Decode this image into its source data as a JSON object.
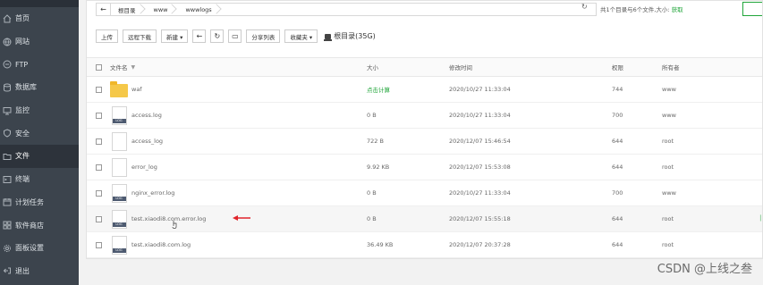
{
  "sidebar": {
    "items": [
      {
        "label": "首页",
        "icon": "home-icon"
      },
      {
        "label": "网站",
        "icon": "globe-icon"
      },
      {
        "label": "FTP",
        "icon": "ftp-icon"
      },
      {
        "label": "数据库",
        "icon": "database-icon"
      },
      {
        "label": "监控",
        "icon": "monitor-icon"
      },
      {
        "label": "安全",
        "icon": "shield-icon"
      },
      {
        "label": "文件",
        "icon": "folder-icon",
        "active": true
      },
      {
        "label": "终端",
        "icon": "terminal-icon"
      },
      {
        "label": "计划任务",
        "icon": "calendar-icon"
      },
      {
        "label": "软件商店",
        "icon": "grid-icon"
      },
      {
        "label": "面板设置",
        "icon": "gear-icon"
      },
      {
        "label": "退出",
        "icon": "logout-icon"
      }
    ]
  },
  "pathbar": {
    "back": "←",
    "crumbs": [
      "根目录",
      "www",
      "wwwlogs"
    ],
    "refresh": "↻",
    "dirinfo_prefix": "共1个目录与6个文件,大小:",
    "dirinfo_link": "获取"
  },
  "toolbar": {
    "upload": "上传",
    "remote_download": "远程下载",
    "new": "新建 ▾",
    "back_icon": "←",
    "refresh_icon": "↻",
    "terminal_icon": "▭",
    "share_list": "分享列表",
    "favorites": "收藏夹 ▾",
    "disk": "根目录(35G)"
  },
  "table": {
    "headers": {
      "name": "文件名",
      "size": "大小",
      "mtime": "修改时间",
      "perm": "权限",
      "owner": "所有者"
    },
    "rows": [
      {
        "type": "folder",
        "name": "waf",
        "size": "点击计算",
        "mtime": "2020/10/27 11:33:04",
        "perm": "744",
        "owner": "www"
      },
      {
        "type": "log",
        "name": "access.log",
        "size": "0 B",
        "mtime": "2020/10/27 11:33:04",
        "perm": "700",
        "owner": "www"
      },
      {
        "type": "file",
        "name": "access_log",
        "size": "722 B",
        "mtime": "2020/12/07 15:46:54",
        "perm": "644",
        "owner": "root"
      },
      {
        "type": "file",
        "name": "error_log",
        "size": "9.92 KB",
        "mtime": "2020/12/07 15:53:08",
        "perm": "644",
        "owner": "root"
      },
      {
        "type": "log",
        "name": "nginx_error.log",
        "size": "0 B",
        "mtime": "2020/10/27 11:33:04",
        "perm": "700",
        "owner": "www"
      },
      {
        "type": "log",
        "name": "test.xiaodi8.com.error.log",
        "size": "0 B",
        "mtime": "2020/12/07 15:55:18",
        "perm": "644",
        "owner": "root"
      },
      {
        "type": "log",
        "name": "test.xiaodi8.com.log",
        "size": "36.49 KB",
        "mtime": "2020/12/07 20:37:28",
        "perm": "644",
        "owner": "root"
      }
    ]
  },
  "watermark": "CSDN @上线之叁",
  "colors": {
    "accent": "#20a53a",
    "sidebar": "#3c444d",
    "arrow": "#e0242b"
  }
}
